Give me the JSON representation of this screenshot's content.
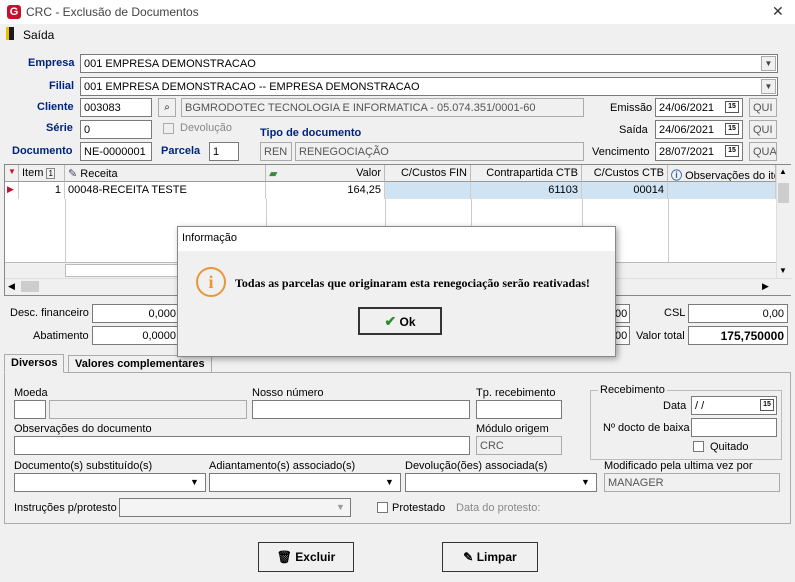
{
  "window": {
    "title": "CRC - Exclusão de Documentos",
    "logo": "G",
    "close": "✕"
  },
  "menu": {
    "saida": "Saída"
  },
  "form": {
    "empresa_label": "Empresa",
    "empresa_value": "001 EMPRESA DEMONSTRACAO",
    "filial_label": "Filial",
    "filial_value": "001 EMPRESA DEMONSTRACAO -- EMPRESA DEMONSTRACAO",
    "cliente_label": "Cliente",
    "cliente_code": "003083",
    "cliente_name": "BGMRODOTEC TECNOLOGIA  E INFORMATICA - 05.074.351/0001-60",
    "serie_label": "Série",
    "serie_value": "0",
    "devolucao_label": "Devolução",
    "documento_label": "Documento",
    "documento_value": "NE-0000001",
    "parcela_label": "Parcela",
    "parcela_value": "1",
    "tipo_label": "Tipo de documento",
    "tipo_code": "REN",
    "tipo_name": "RENEGOCIAÇÃO",
    "emissao_label": "Emissão",
    "emissao_date": "24/06/2021",
    "emissao_day": "QUI",
    "saida_label": "Saída",
    "saida_date": "24/06/2021",
    "saida_day": "QUI",
    "vencimento_label": "Vencimento",
    "vencimento_date": "28/07/2021",
    "vencimento_day": "QUA",
    "cal_icon": "15"
  },
  "grid": {
    "headers": {
      "item": "Item",
      "item_sort": "1",
      "receita": "Receita",
      "valor": "Valor",
      "ccustos_fin": "C/Custos FIN",
      "contrapartida": "Contrapartida CTB",
      "ccustos_ctb": "C/Custos CTB",
      "obs": "Observações do ite"
    },
    "row": {
      "item": "1",
      "receita": "00048-RECEITA TESTE",
      "valor": "164,25",
      "contrapartida": "61103",
      "ccustos_ctb": "00014"
    }
  },
  "totals": {
    "desc_label": "Desc. financeiro",
    "desc_value": "0,000",
    "abat_label": "Abatimento",
    "abat_value": "0,0000",
    "csl_label": "CSL",
    "csl_value": "0,00",
    "csl_left": "00",
    "total_label": "Valor total",
    "total_value": "175,750000",
    "total_left": "00"
  },
  "tabs": {
    "diversos": "Diversos",
    "valores": "Valores complementares"
  },
  "diversos": {
    "moeda_label": "Moeda",
    "nosso_label": "Nosso número",
    "tprec_label": "Tp. recebimento",
    "receb_group": "Recebimento",
    "data_label": "Data",
    "data_value": " /  /",
    "ndocto_label": "Nº docto de baixa",
    "quitado_label": "Quitado",
    "obs_label": "Observações do documento",
    "modulo_label": "Módulo origem",
    "modulo_value": "CRC",
    "docsub_label": "Documento(s) substituído(s)",
    "adiant_label": "Adiantamento(s) associado(s)",
    "devol_label": "Devolução(ões) associada(s)",
    "modif_label": "Modificado pela ultima vez por",
    "modif_value": "MANAGER",
    "instr_label": "Instruções p/protesto",
    "protestado_label": "Protestado",
    "dataprot_label": "Data do protesto:"
  },
  "buttons": {
    "excluir": "Excluir",
    "limpar": "Limpar"
  },
  "dialog": {
    "title": "Informação",
    "message": "Todas as parcelas que originaram esta renegociação serão reativadas!",
    "ok": "Ok",
    "info_icon": "i"
  },
  "colors": {
    "label_blue": "#00247d",
    "accent_red": "#c8102e",
    "info_orange": "#e8963a",
    "row_blue": "#cfe3f3"
  }
}
